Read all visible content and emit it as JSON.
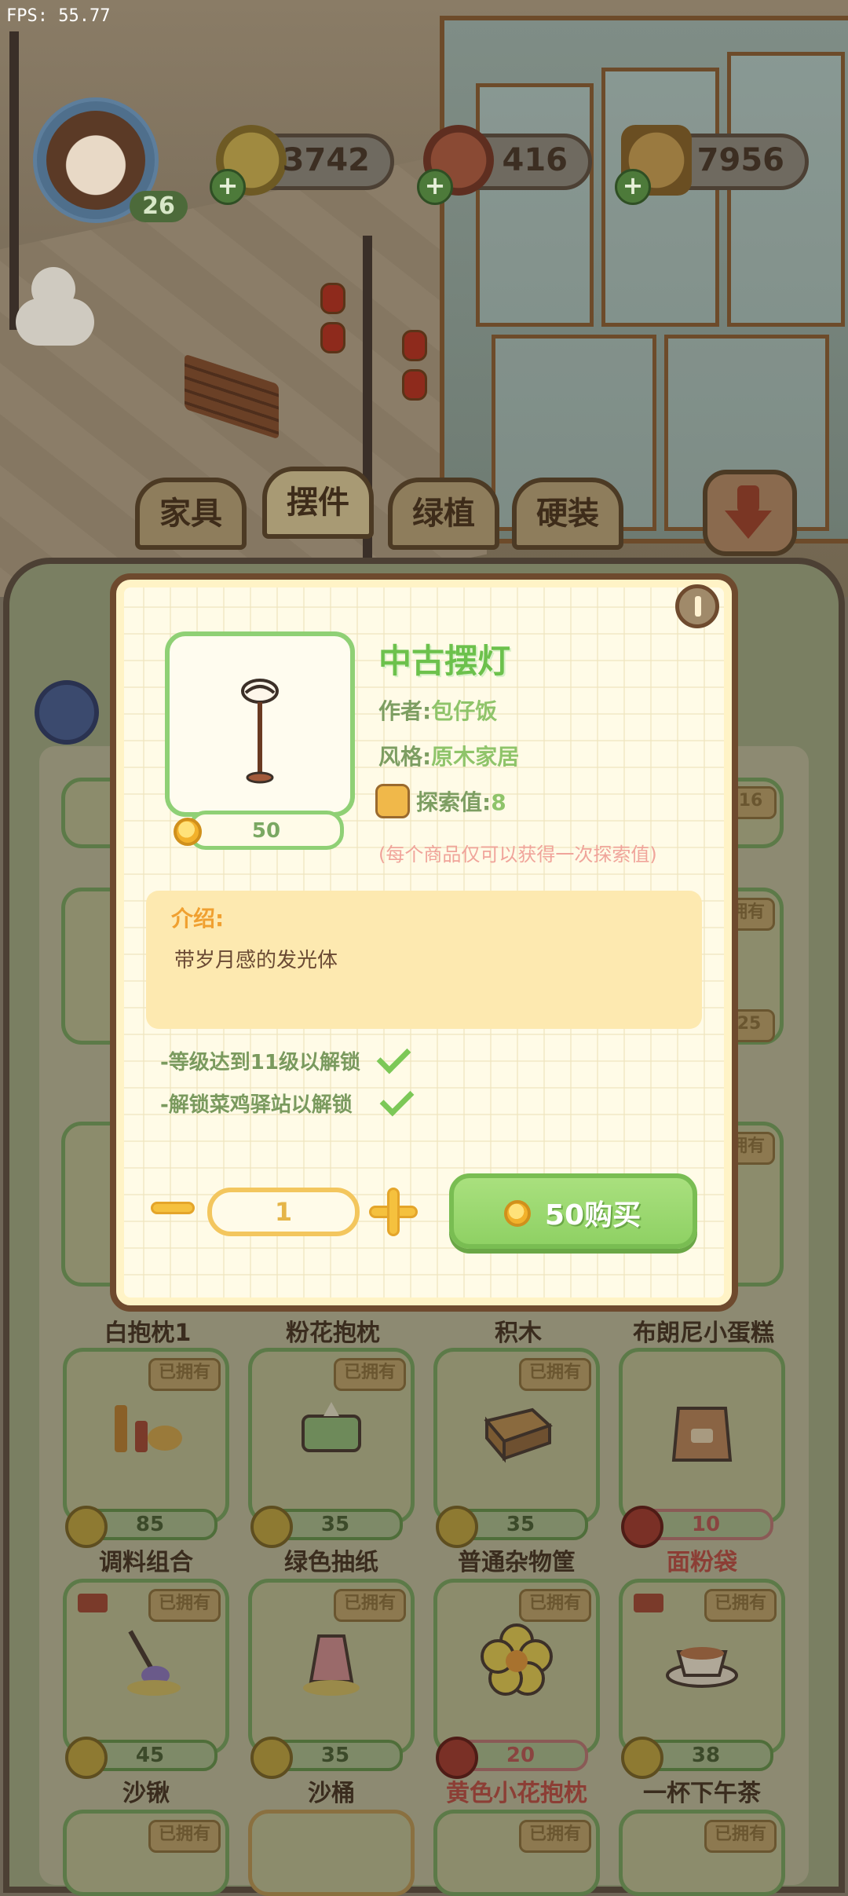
{
  "debug": {
    "fps": "FPS: 55.77"
  },
  "hud": {
    "level": "26",
    "currencies": [
      {
        "icon": "gold-coin-icon",
        "value": "3742"
      },
      {
        "icon": "meat-icon",
        "value": "416"
      },
      {
        "icon": "explore-book-icon",
        "value": "7956"
      }
    ]
  },
  "tabs": [
    {
      "label": "家具"
    },
    {
      "label": "摆件",
      "active": true
    },
    {
      "label": "绿植"
    },
    {
      "label": "硬装"
    }
  ],
  "modal": {
    "title": "中古摆灯",
    "price": "50",
    "author_label": "作者:",
    "author": "包仔饭",
    "style_label": "风格:",
    "style": "原木家居",
    "explore_label": "探索值:",
    "explore_value": "8",
    "explore_note": "(每个商品仅可以获得一次探索值)",
    "intro_title": "介绍:",
    "intro_text": "带岁月感的发光体",
    "requirements": [
      {
        "text": "-等级达到11级以解锁",
        "met": true
      },
      {
        "text": "-解锁菜鸡驿站以解锁",
        "met": true
      }
    ],
    "quantity": "1",
    "buy_label": "50购买"
  },
  "shop": {
    "owned_badge": "已拥有",
    "partial_badges": [
      "16",
      "25"
    ],
    "row_names_top": [
      "白抱枕1",
      "粉花抱枕",
      "积木",
      "布朗尼小蛋糕"
    ],
    "rows": [
      {
        "items": [
          {
            "name": "调料组合",
            "price": "85",
            "owned": true,
            "truck": false,
            "locked": false
          },
          {
            "name": "绿色抽纸",
            "price": "35",
            "owned": true,
            "truck": false,
            "locked": false
          },
          {
            "name": "普通杂物筐",
            "price": "35",
            "owned": true,
            "truck": false,
            "locked": false
          },
          {
            "name": "面粉袋",
            "price": "10",
            "owned": false,
            "truck": false,
            "locked": true
          }
        ]
      },
      {
        "items": [
          {
            "name": "沙锹",
            "price": "45",
            "owned": true,
            "truck": true,
            "locked": false
          },
          {
            "name": "沙桶",
            "price": "35",
            "owned": true,
            "truck": false,
            "locked": false
          },
          {
            "name": "黄色小花抱枕",
            "price": "20",
            "owned": true,
            "truck": false,
            "locked": true
          },
          {
            "name": "一杯下午茶",
            "price": "38",
            "owned": true,
            "truck": true,
            "locked": false
          }
        ]
      }
    ]
  },
  "colors": {
    "accent_green": "#8fd164",
    "title_green": "#6cc14c",
    "coin_gold": "#f2b12b",
    "frame_brown": "#6e4a2e"
  }
}
